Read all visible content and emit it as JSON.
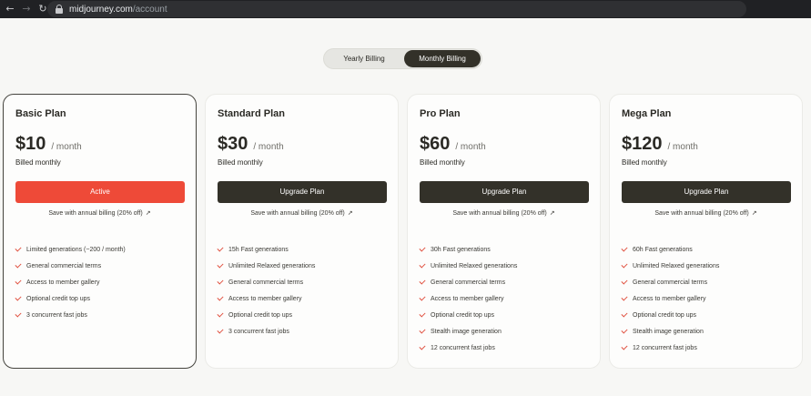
{
  "browser": {
    "back_icon": "arrow-left-icon",
    "forward_icon": "arrow-right-icon",
    "reload_icon": "reload-icon",
    "url_host": "midjourney.com",
    "url_path": "/account"
  },
  "billing_toggle": {
    "yearly_label": "Yearly Billing",
    "monthly_label": "Monthly Billing",
    "selected": "monthly"
  },
  "colors": {
    "active_button": "#ee4a38",
    "upgrade_button": "#333129",
    "check": "#e0503f"
  },
  "plans": [
    {
      "name": "Basic Plan",
      "price": "$10",
      "per": "/ month",
      "billed": "Billed monthly",
      "button_label": "Active",
      "active": true,
      "save_label": "Save with annual billing (20% off)",
      "features": [
        "Limited generations (~200 / month)",
        "General commercial terms",
        "Access to member gallery",
        "Optional credit top ups",
        "3 concurrent fast jobs"
      ]
    },
    {
      "name": "Standard Plan",
      "price": "$30",
      "per": "/ month",
      "billed": "Billed monthly",
      "button_label": "Upgrade Plan",
      "active": false,
      "save_label": "Save with annual billing (20% off)",
      "features": [
        "15h Fast generations",
        "Unlimited Relaxed generations",
        "General commercial terms",
        "Access to member gallery",
        "Optional credit top ups",
        "3 concurrent fast jobs"
      ]
    },
    {
      "name": "Pro Plan",
      "price": "$60",
      "per": "/ month",
      "billed": "Billed monthly",
      "button_label": "Upgrade Plan",
      "active": false,
      "save_label": "Save with annual billing (20% off)",
      "features": [
        "30h Fast generations",
        "Unlimited Relaxed generations",
        "General commercial terms",
        "Access to member gallery",
        "Optional credit top ups",
        "Stealth image generation",
        "12 concurrent fast jobs"
      ]
    },
    {
      "name": "Mega Plan",
      "price": "$120",
      "per": "/ month",
      "billed": "Billed monthly",
      "button_label": "Upgrade Plan",
      "active": false,
      "save_label": "Save with annual billing (20% off)",
      "features": [
        "60h Fast generations",
        "Unlimited Relaxed generations",
        "General commercial terms",
        "Access to member gallery",
        "Optional credit top ups",
        "Stealth image generation",
        "12 concurrent fast jobs"
      ]
    }
  ]
}
